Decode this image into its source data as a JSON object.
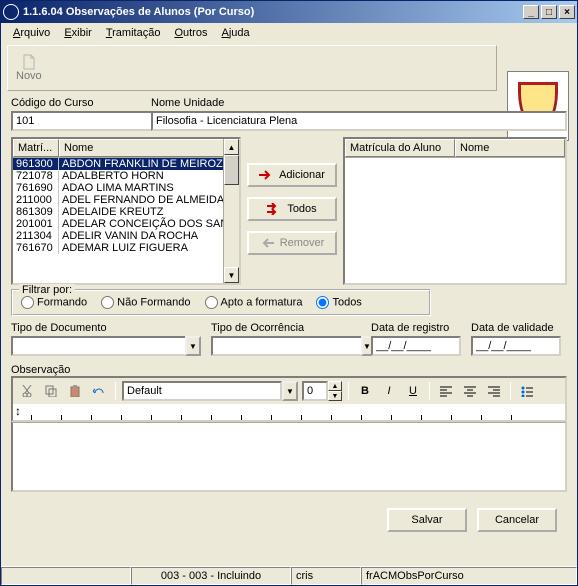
{
  "title": "1.1.6.04 Observações de Alunos (Por  Curso)",
  "menu": {
    "arquivo": "Arquivo",
    "exibir": "Exibir",
    "tramitacao": "Tramitação",
    "outros": "Outros",
    "ajuda": "Ajuda"
  },
  "toolbar": {
    "novo": "Novo"
  },
  "labels": {
    "codigo": "Código do Curso",
    "nome_unidade": "Nome Unidade",
    "matri": "Matrí...",
    "nome": "Nome",
    "matricula_aluno": "Matrícula do Aluno",
    "adicionar": "Adicionar",
    "todos": "Todos",
    "remover": "Remover",
    "filtrar": "Filtrar por:",
    "formando": "Formando",
    "nao_formando": "Não Formando",
    "apto": "Apto a formatura",
    "filtro_todos": "Todos",
    "tipo_doc": "Tipo de Documento",
    "tipo_ocor": "Tipo de Ocorrência",
    "data_reg": "Data de registro",
    "data_val": "Data de validade",
    "observacao": "Observação",
    "font": "Default",
    "size": "0",
    "salvar": "Salvar",
    "cancelar": "Cancelar",
    "date_mask": "__/__/____"
  },
  "codigo": "101",
  "nome_unidade": "Filosofia - Licenciatura Plena",
  "alunos": [
    {
      "mat": "961300",
      "nome": "ABDON FRANKLIN DE MEIROZ",
      "sel": true
    },
    {
      "mat": "721078",
      "nome": "ADALBERTO HORN"
    },
    {
      "mat": "761690",
      "nome": "ADAO LIMA MARTINS"
    },
    {
      "mat": "211000",
      "nome": "ADEL FERNANDO DE ALMEIDA"
    },
    {
      "mat": "861309",
      "nome": "ADELAIDE KREUTZ"
    },
    {
      "mat": "201001",
      "nome": "ADELAR CONCEIÇÃO DOS SAN"
    },
    {
      "mat": "211304",
      "nome": "ADELIR VANIN DA ROCHA"
    },
    {
      "mat": "761670",
      "nome": "ADEMAR LUIZ FIGUERA"
    }
  ],
  "status": {
    "pos": "003 - 003 - Incluindo",
    "user": "cris",
    "form": "frACMObsPorCurso"
  }
}
